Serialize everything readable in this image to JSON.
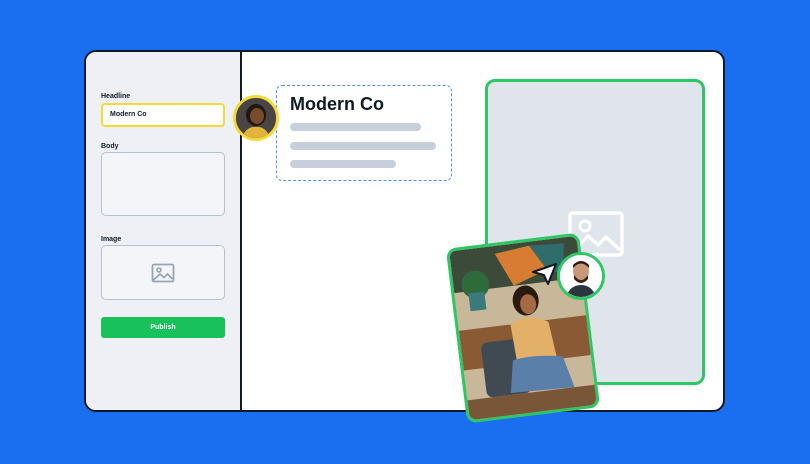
{
  "sidebar": {
    "headline_label": "Headline",
    "headline_value": "Modern Co",
    "body_label": "Body",
    "image_label": "Image",
    "publish_label": "Publish"
  },
  "canvas": {
    "title": "Modern Co"
  },
  "icons": {
    "image_placeholder": "image-icon",
    "cursor": "cursor-arrow-icon"
  },
  "colors": {
    "background": "#1a6ef0",
    "accent_green": "#18c15a",
    "focus_yellow": "#f3d93a",
    "dashed_blue": "#5b8fd9"
  }
}
